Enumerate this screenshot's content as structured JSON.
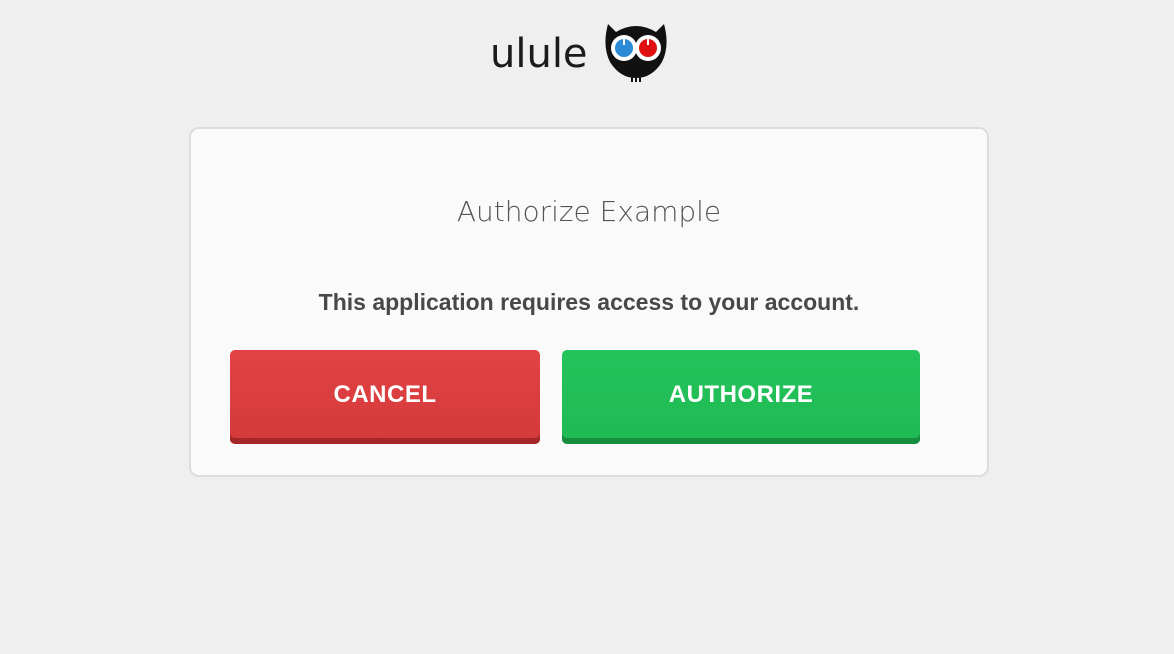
{
  "logo": {
    "text": "ulule",
    "icon": "owl-logo-icon"
  },
  "dialog": {
    "title": "Authorize Example",
    "message": "This application requires access to your account.",
    "cancel_label": "CANCEL",
    "authorize_label": "AUTHORIZE"
  },
  "colors": {
    "cancel": "#dd3e3f",
    "authorize": "#22c158",
    "background": "#efefef"
  }
}
